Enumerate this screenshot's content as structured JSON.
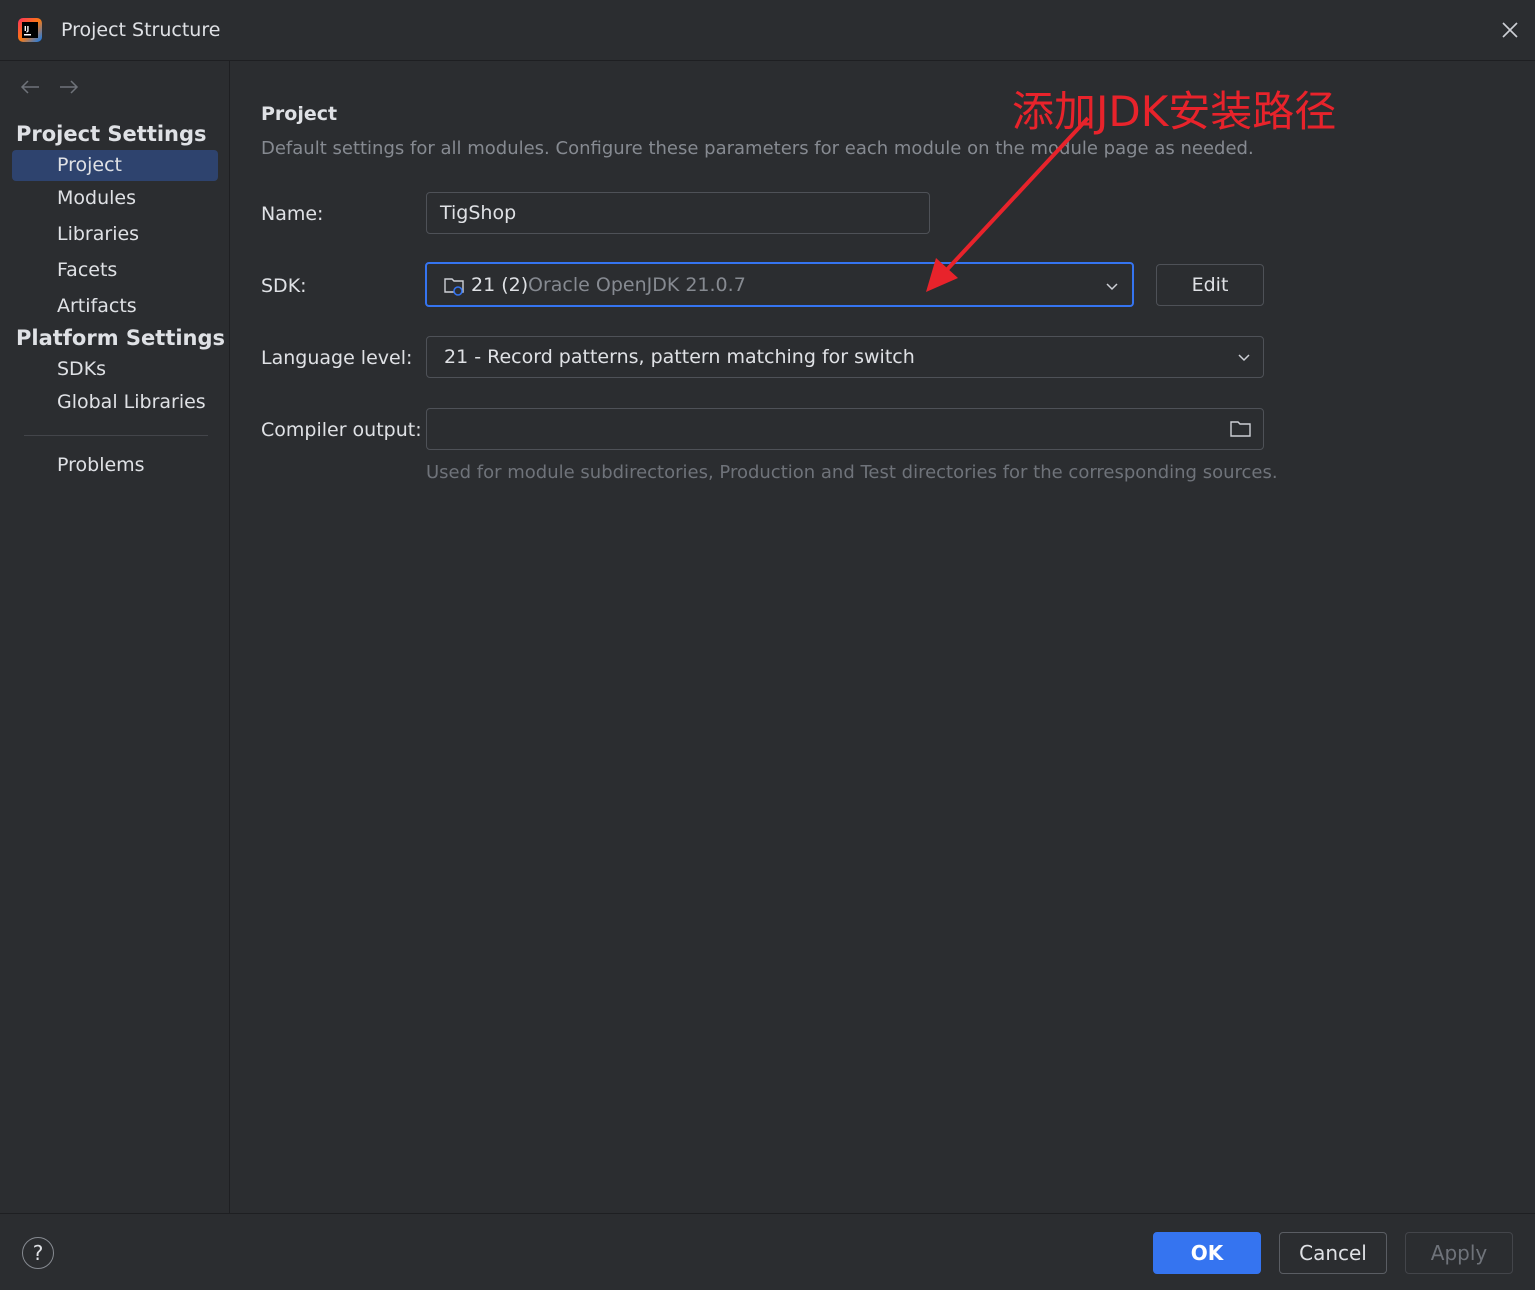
{
  "window": {
    "title": "Project Structure",
    "icon": "intellij-idea-icon"
  },
  "sidebar": {
    "groups": [
      {
        "title": "Project Settings",
        "items": [
          "Project",
          "Modules",
          "Libraries",
          "Facets",
          "Artifacts"
        ]
      },
      {
        "title": "Platform Settings",
        "items": [
          "SDKs",
          "Global Libraries"
        ]
      }
    ],
    "extra_item": "Problems",
    "selected": "Project"
  },
  "main": {
    "title": "Project",
    "description": "Default settings for all modules. Configure these parameters for each module on the module page as needed.",
    "name_label": "Name:",
    "name_value": "TigShop",
    "sdk_label": "SDK:",
    "sdk_version": "21 (2)",
    "sdk_vendor": "Oracle OpenJDK 21.0.7",
    "edit_button": "Edit",
    "language_level_label": "Language level:",
    "language_level_value": "21 - Record patterns, pattern matching for switch",
    "compiler_output_label": "Compiler output:",
    "compiler_output_value": "",
    "compiler_output_hint": "Used for module subdirectories, Production and Test directories for the corresponding sources."
  },
  "annotation": {
    "text": "添加JDK安装路径",
    "color": "#e8232b"
  },
  "footer": {
    "help": "?",
    "ok": "OK",
    "cancel": "Cancel",
    "apply": "Apply"
  },
  "colors": {
    "background": "#2b2d30",
    "accent": "#3574f0",
    "selection": "#2e436e"
  }
}
